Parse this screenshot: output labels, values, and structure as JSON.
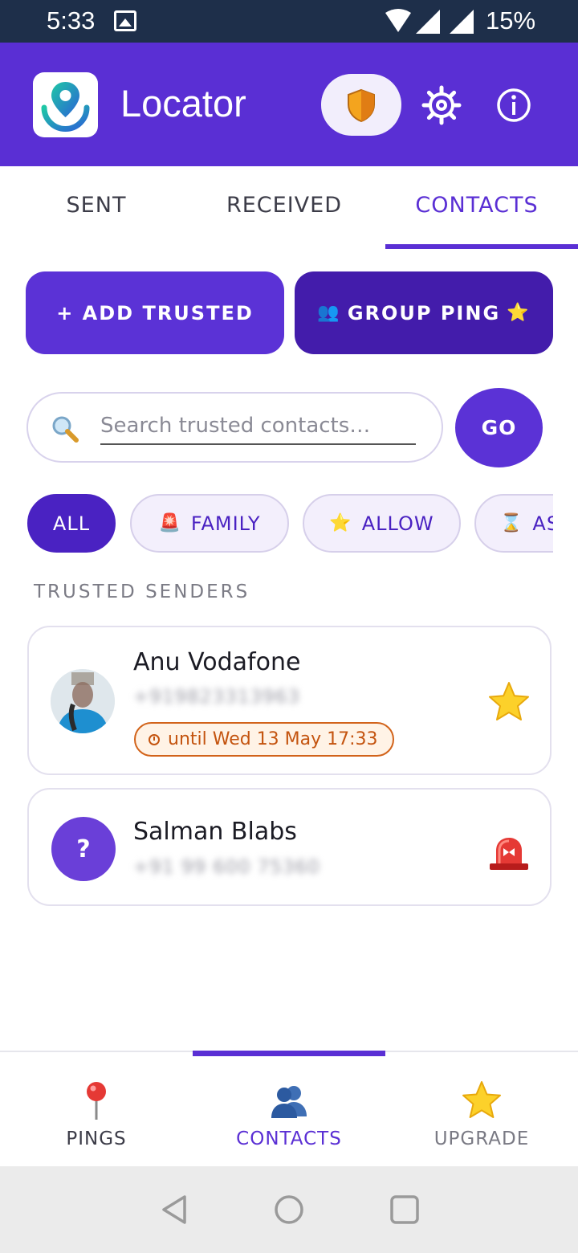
{
  "status_bar": {
    "time": "5:33",
    "battery": "15%"
  },
  "app_bar": {
    "title": "Locator"
  },
  "tabs": [
    {
      "label": "SENT",
      "active": false
    },
    {
      "label": "RECEIVED",
      "active": false
    },
    {
      "label": "CONTACTS",
      "active": true
    }
  ],
  "actions": {
    "add_trusted": "+ ADD TRUSTED",
    "group_ping": "GROUP PING"
  },
  "search": {
    "placeholder": "Search trusted contacts…",
    "go": "GO"
  },
  "filters": [
    {
      "label": "ALL",
      "active": true
    },
    {
      "label": "FAMILY",
      "icon": "siren-icon"
    },
    {
      "label": "ALLOW",
      "icon": "star-icon"
    },
    {
      "label": "AS",
      "icon": "hourglass-icon"
    }
  ],
  "section": {
    "label": "TRUSTED SENDERS"
  },
  "contacts": [
    {
      "name": "Anu Vodafone",
      "phone": "+919823313963",
      "badge": "until Wed 13 May 17:33",
      "tag_icon": "star-icon"
    },
    {
      "name": "Salman Blabs",
      "avatar_text": "?",
      "phone": "+91 99 600 75360",
      "tag_icon": "siren-icon"
    }
  ],
  "bottom_nav": [
    {
      "label": "PINGS",
      "icon": "pin-icon"
    },
    {
      "label": "CONTACTS",
      "icon": "contacts-icon",
      "active": true
    },
    {
      "label": "UPGRADE",
      "icon": "star-icon"
    }
  ],
  "colors": {
    "primary": "#5a2fd4",
    "primary_dark": "#431cab",
    "status_bar": "#1e2f4a",
    "badge_orange": "#d2631a"
  }
}
